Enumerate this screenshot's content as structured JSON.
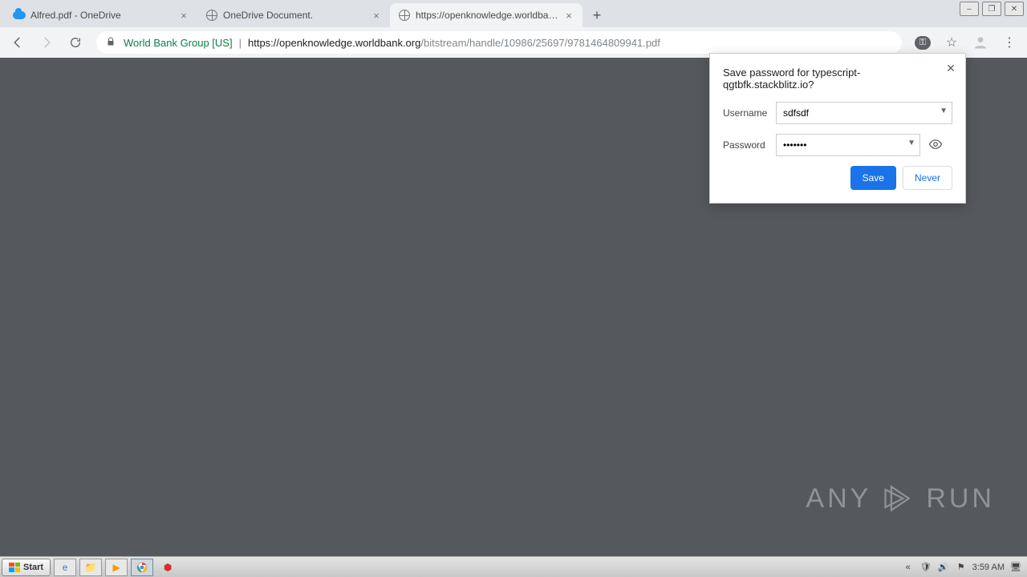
{
  "tabs": [
    {
      "title": "Alfred.pdf - OneDrive",
      "favicon": "onedrive"
    },
    {
      "title": "OneDrive Document.",
      "favicon": "globe"
    },
    {
      "title": "https://openknowledge.worldbank.o",
      "favicon": "globe"
    }
  ],
  "active_tab_index": 2,
  "address": {
    "ev_label": "World Bank Group [US]",
    "host": "https://openknowledge.worldbank.org",
    "path": "/bitstream/handle/10986/25697/9781464809941.pdf"
  },
  "password_popup": {
    "title": "Save password for typescript-qgtbfk.stackblitz.io?",
    "username_label": "Username",
    "username_value": "sdfsdf",
    "password_label": "Password",
    "password_value": "•••••••",
    "save_label": "Save",
    "never_label": "Never"
  },
  "watermark": {
    "left": "ANY",
    "right": "RUN"
  },
  "taskbar": {
    "start_label": "Start",
    "clock": "3:59 AM"
  }
}
